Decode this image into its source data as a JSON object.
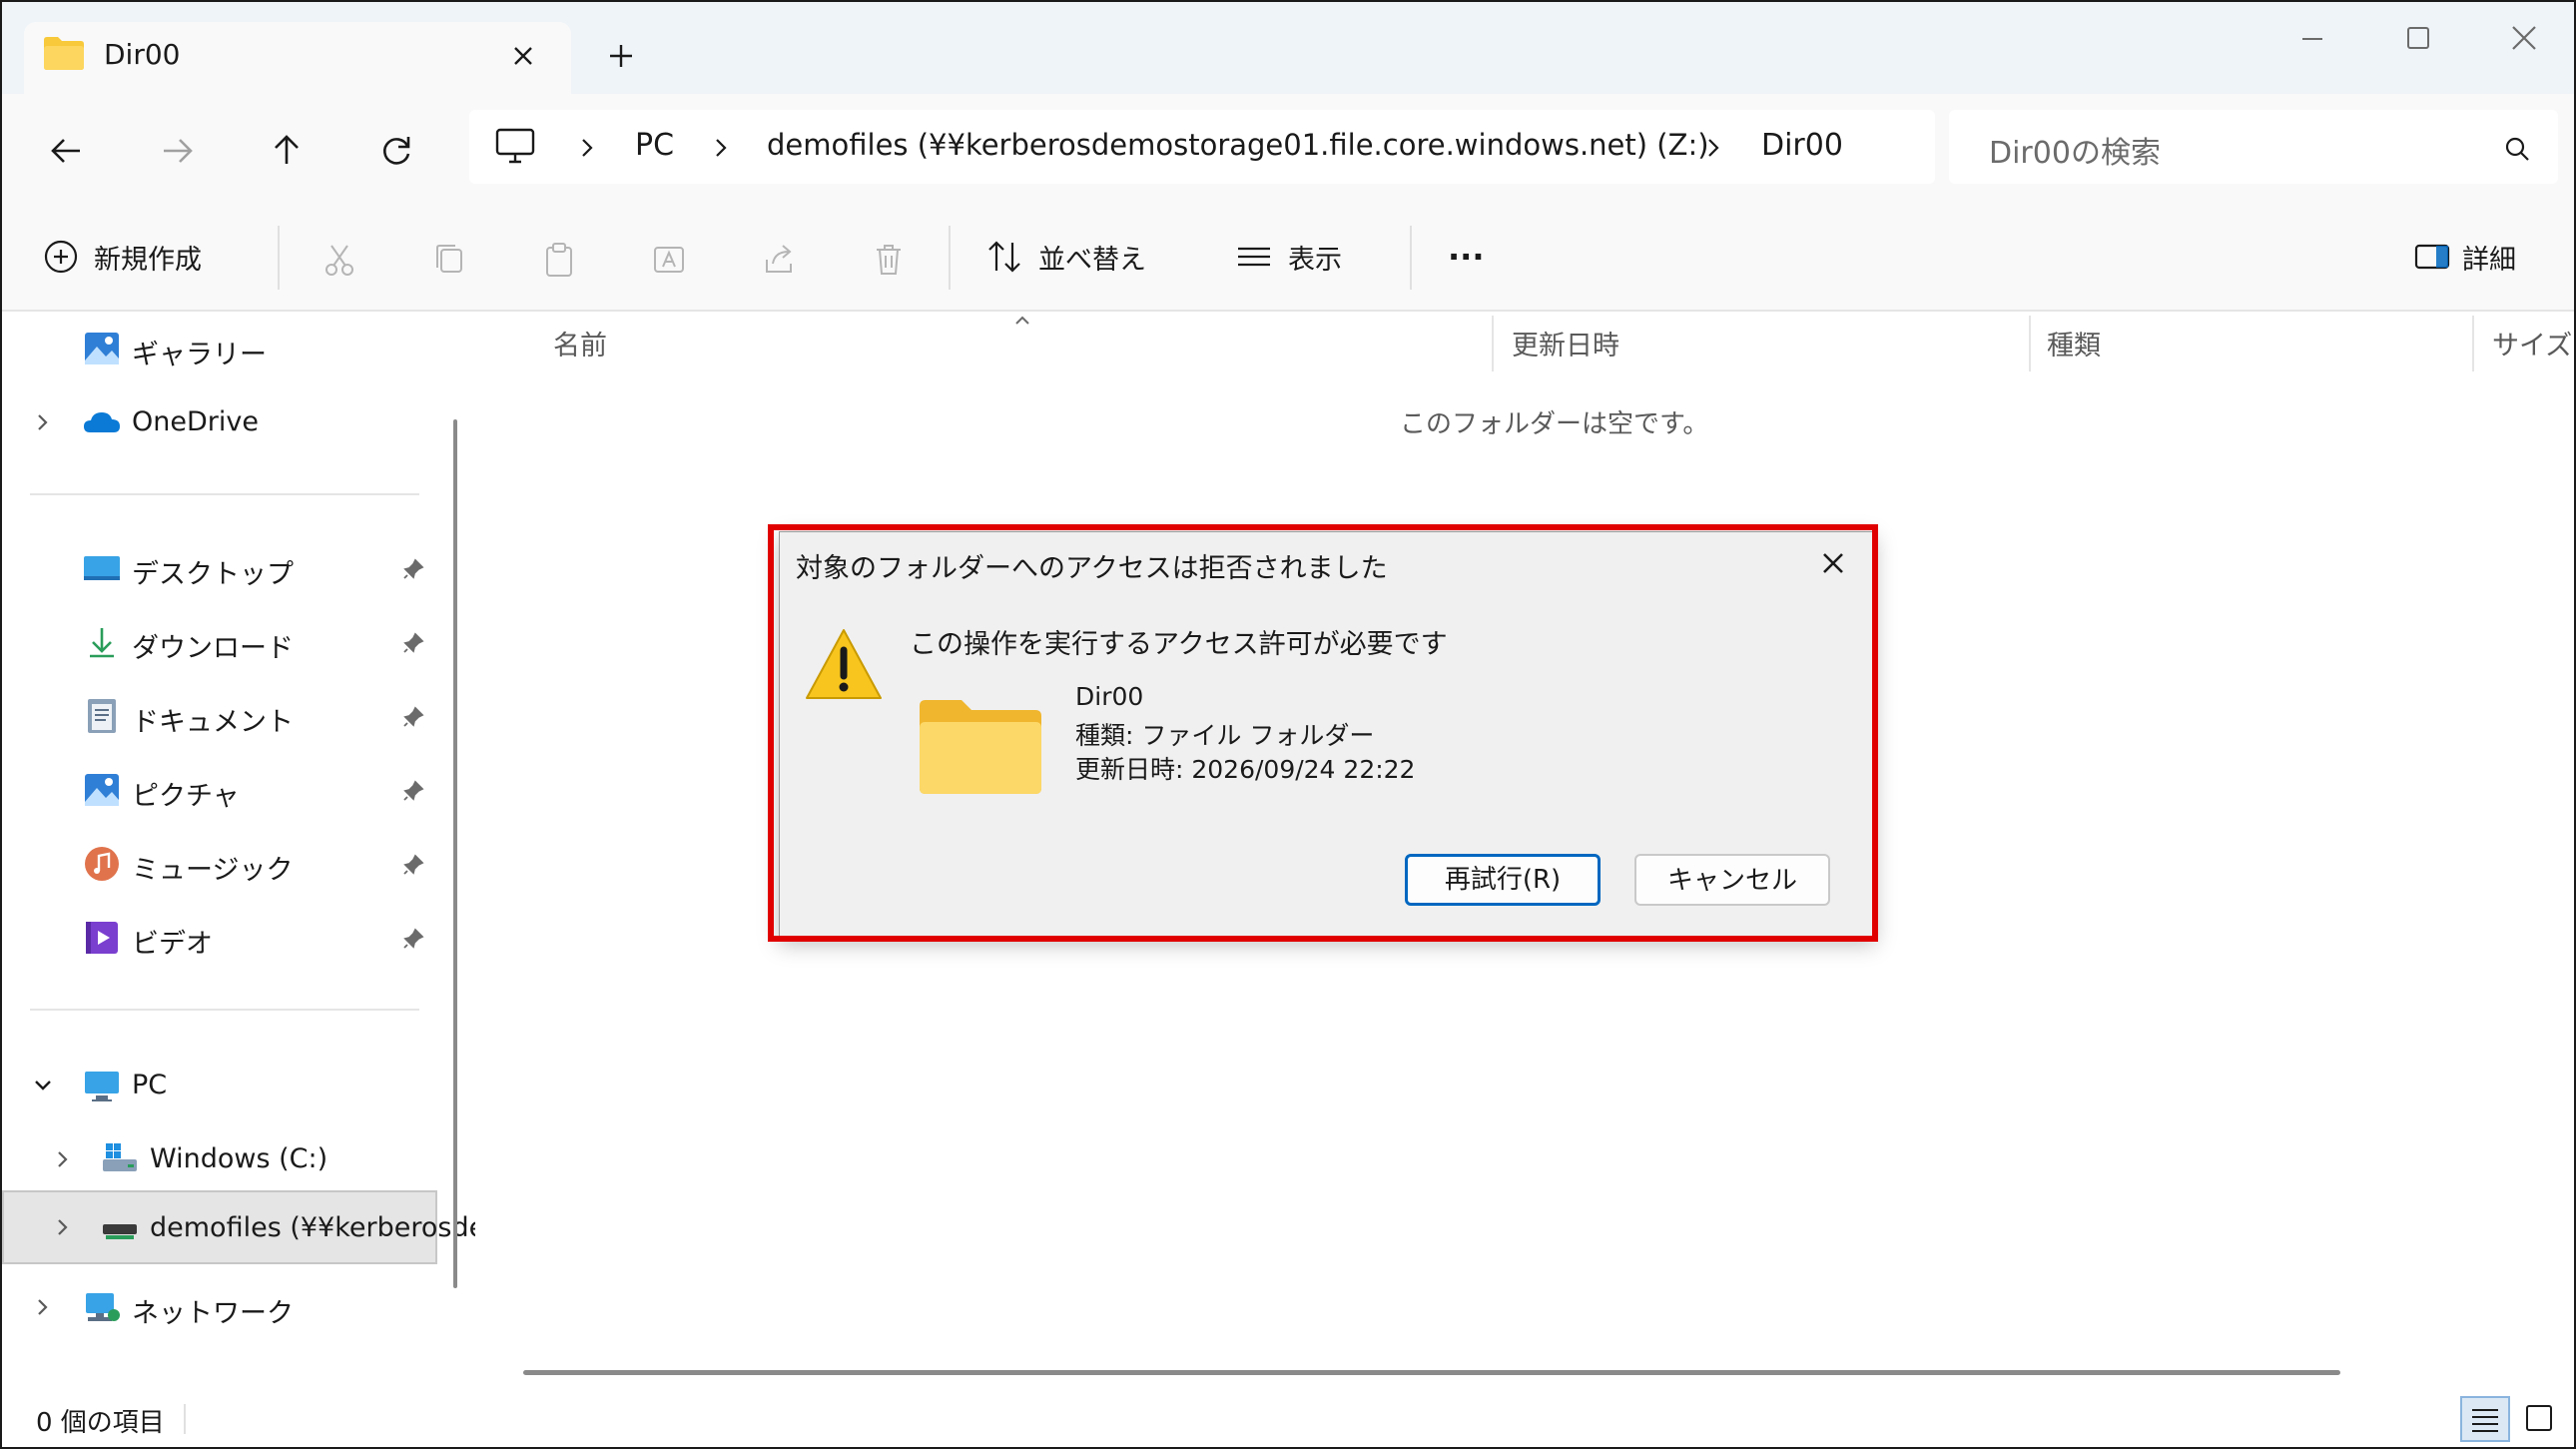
{
  "window": {
    "tab_title": "Dir00",
    "colors": {
      "accent": "#0067c0",
      "highlight": "#e00000",
      "folder": "#f8c93a"
    }
  },
  "navigation": {
    "breadcrumb": [
      "PC",
      "demofiles (¥¥kerberosdemostorage01.file.core.windows.net) (Z:)",
      "Dir00"
    ],
    "search_placeholder": "Dir00の検索"
  },
  "commandbar": {
    "new": "新規作成",
    "sort": "並べ替え",
    "view": "表示",
    "more": "···",
    "details": "詳細"
  },
  "sidebar": {
    "top_items": [
      {
        "label": "ギャラリー",
        "icon": "gallery-icon"
      },
      {
        "label": "OneDrive",
        "icon": "onedrive-icon"
      }
    ],
    "quick_access": [
      {
        "label": "デスクトップ",
        "icon": "desktop-icon"
      },
      {
        "label": "ダウンロード",
        "icon": "download-icon"
      },
      {
        "label": "ドキュメント",
        "icon": "document-icon"
      },
      {
        "label": "ピクチャ",
        "icon": "pictures-icon"
      },
      {
        "label": "ミュージック",
        "icon": "music-icon"
      },
      {
        "label": "ビデオ",
        "icon": "video-icon"
      }
    ],
    "pc": "PC",
    "drives": [
      {
        "label": "Windows (C:)",
        "icon": "windows-drive-icon"
      },
      {
        "label": "demofiles (¥¥kerberosde",
        "icon": "network-drive-icon"
      }
    ],
    "network": "ネットワーク"
  },
  "content": {
    "columns": [
      "名前",
      "更新日時",
      "種類",
      "サイズ"
    ],
    "empty_message": "このフォルダーは空です。"
  },
  "status": {
    "item_count": "0 個の項目"
  },
  "dialog": {
    "title": "対象のフォルダーへのアクセスは拒否されました",
    "message": "この操作を実行するアクセス許可が必要です",
    "folder_name": "Dir00",
    "folder_type": "種類: ファイル フォルダー",
    "modified": "更新日時: 2026/09/24 22:22",
    "retry_label": "再試行(R)",
    "cancel_label": "キャンセル"
  }
}
